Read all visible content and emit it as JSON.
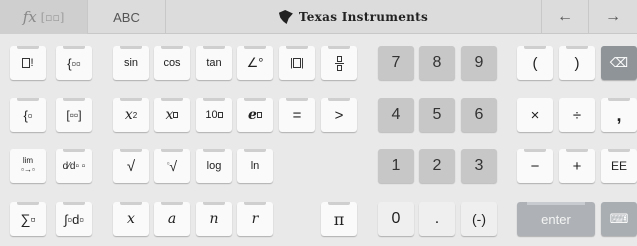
{
  "topbar": {
    "fx_label": "fx",
    "abc_label": "ABC",
    "brand": "Texas Instruments",
    "left_arrow": "←",
    "right_arrow": "→"
  },
  "keys": {
    "sin": "sin",
    "cos": "cos",
    "tan": "tan",
    "log": "log",
    "ln": "ln",
    "x_sq": "x",
    "x_sq_sup": "2",
    "x_pow": "x",
    "ten": "10",
    "e": "e",
    "equals": "=",
    "greater": ">",
    "pi": "π",
    "x_var": "x",
    "a_var": "a",
    "n_var": "n",
    "r_var": "r",
    "lim": "lim",
    "n7": "7",
    "n8": "8",
    "n9": "9",
    "n4": "4",
    "n5": "5",
    "n6": "6",
    "n1": "1",
    "n2": "2",
    "n3": "3",
    "n0": "0",
    "dot": ".",
    "neg": "(-)",
    "lparen": "(",
    "rparen": ")",
    "times": "×",
    "divide": "÷",
    "comma": ",",
    "minus": "−",
    "plus": "+",
    "ee": "EE",
    "enter": "enter",
    "fact": "!",
    "sqrt": "√",
    "nroot": "√"
  }
}
